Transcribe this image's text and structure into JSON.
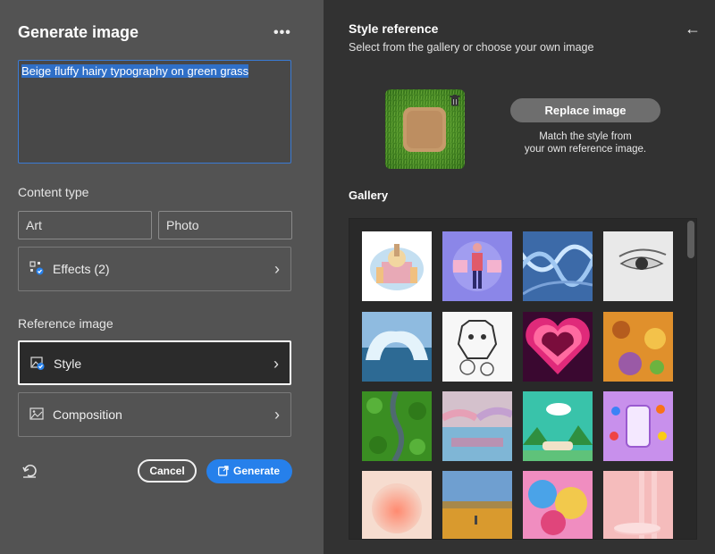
{
  "left": {
    "title": "Generate image",
    "more_label": "•••",
    "prompt_text": "Beige fluffy hairy typography on green grass",
    "content_type_label": "Content type",
    "options": {
      "art": "Art",
      "photo": "Photo"
    },
    "effects_label": "Effects (2)",
    "reference_image_label": "Reference image",
    "style_label": "Style",
    "composition_label": "Composition",
    "cancel_label": "Cancel",
    "generate_label": "Generate",
    "accent": "#2680eb"
  },
  "right": {
    "title": "Style reference",
    "subtitle": "Select from the gallery or choose your own image",
    "replace_label": "Replace image",
    "match_line1": "Match the style from",
    "match_line2": "your own reference image.",
    "gallery_label": "Gallery"
  },
  "icons": {
    "more": "more-icon",
    "effects": "effects-icon",
    "style": "style-icon",
    "composition": "composition-icon",
    "chevron": "chevron-right-icon",
    "reset": "reset-icon",
    "generate": "generate-icon",
    "back": "arrow-left-icon",
    "trash": "trash-icon"
  }
}
